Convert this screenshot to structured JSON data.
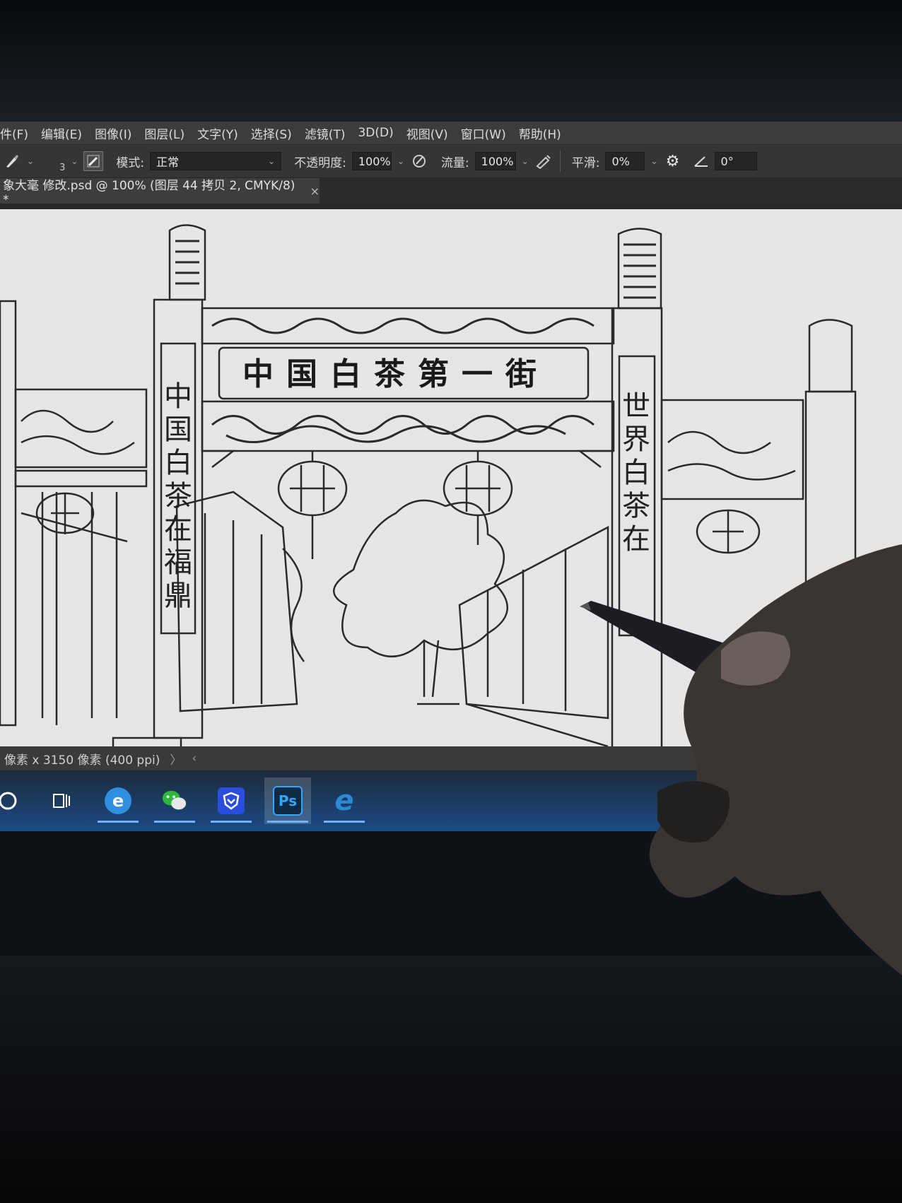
{
  "menubar": {
    "items": [
      "件(F)",
      "编辑(E)",
      "图像(I)",
      "图层(L)",
      "文字(Y)",
      "选择(S)",
      "滤镜(T)",
      "3D(D)",
      "视图(V)",
      "窗口(W)",
      "帮助(H)"
    ]
  },
  "options": {
    "brush_size": "3",
    "mode_label": "模式:",
    "mode_value": "正常",
    "opacity_label": "不透明度:",
    "opacity_value": "100%",
    "flow_label": "流量:",
    "flow_value": "100%",
    "smoothing_label": "平滑:",
    "smoothing_value": "0%",
    "angle_value": "0°"
  },
  "document_tab": {
    "title": "象大毫 修改.psd @ 100% (图层 44 拷贝 2, CMYK/8) *",
    "close": "×"
  },
  "artwork": {
    "sign": "中国白茶第一街",
    "left_pillar": "中国白茶在福鼎",
    "right_pillar": "世界白茶在"
  },
  "statusbar": {
    "dimensions": "像素 x 3150 像素 (400 ppi)",
    "arrow": "〉",
    "scroll_left": "‹"
  },
  "taskbar": {
    "items": [
      {
        "name": "edge-icon",
        "label": "e",
        "color": "#2f8fe0"
      },
      {
        "name": "wechat-icon",
        "label": "",
        "color": "#2db83d"
      },
      {
        "name": "security-icon",
        "label": "",
        "color": "#2b4dde"
      },
      {
        "name": "photoshop-icon",
        "label": "Ps",
        "color": "#0f2a44"
      },
      {
        "name": "ie-icon",
        "label": "e",
        "color": "#2a8ad6"
      }
    ]
  },
  "colors": {
    "photoshop_dark": "#353535",
    "canvas": "#e6e6e6",
    "taskbar_blue": "#1a4b86"
  }
}
